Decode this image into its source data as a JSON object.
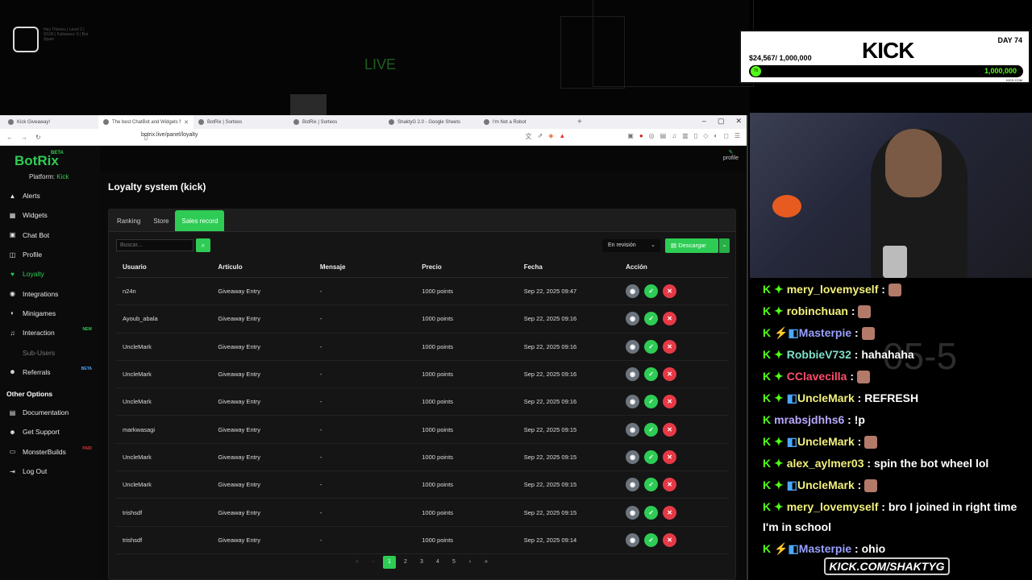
{
  "stream": {
    "bg_live": "LIVE",
    "bg_logo_text": "Hey Thieves | Level 2 | 0/100 | Followers: 0 | Bot Spam",
    "goal": {
      "amount": "$24,567/ 1,000,000",
      "brand": "KICK",
      "day": "DAY 74",
      "knob": "75",
      "target": "1,000,000",
      "site": "KICK.COM"
    },
    "chat_bg_number": "05-5",
    "kick_link": "KICK.COM/SHAKTYG",
    "chat": [
      {
        "badges": "K ✦",
        "badge2": "",
        "name": "mery_lovemyself",
        "name_color": "#f2f07a",
        "msg": "",
        "emote": true
      },
      {
        "badges": "K ✦",
        "badge2": "",
        "name": "robinchuan",
        "name_color": "#f2f07a",
        "msg": "",
        "emote": true
      },
      {
        "badges": "K",
        "badge2": "⚡◧",
        "name": "Masterpie",
        "name_color": "#9aa0ff",
        "msg": "",
        "emote": true
      },
      {
        "badges": "K ✦",
        "badge2": "",
        "name": "RobbieV732",
        "name_color": "#7ee0c9",
        "msg": "hahahaha",
        "emote": false
      },
      {
        "badges": "K ✦",
        "badge2": "",
        "name": "CClavecilla",
        "name_color": "#ff4d6d",
        "msg": "",
        "emote": true
      },
      {
        "badges": "K ✦",
        "badge2": "◧",
        "name": "UncleMark",
        "name_color": "#f2f07a",
        "msg": "REFRESH",
        "emote": false
      },
      {
        "badges": "K",
        "badge2": "",
        "name": "mrabsjdhhs6",
        "name_color": "#b9a8ff",
        "msg": "!p",
        "emote": false
      },
      {
        "badges": "K ✦",
        "badge2": "◧",
        "name": "UncleMark",
        "name_color": "#f2f07a",
        "msg": "",
        "emote": true
      },
      {
        "badges": "K ✦",
        "badge2": "",
        "name": "alex_aylmer03",
        "name_color": "#f2f07a",
        "msg": "spin the bot wheel lol",
        "emote": false
      },
      {
        "badges": "K ✦",
        "badge2": "◧",
        "name": "UncleMark",
        "name_color": "#f2f07a",
        "msg": "",
        "emote": true
      },
      {
        "badges": "K ✦",
        "badge2": "",
        "name": "mery_lovemyself",
        "name_color": "#f2f07a",
        "msg": "bro I joined in right time I'm in school",
        "emote": false
      },
      {
        "badges": "K",
        "badge2": "⚡◧",
        "name": "Masterpie",
        "name_color": "#9aa0ff",
        "msg": "ohio",
        "emote": false
      }
    ]
  },
  "browser": {
    "tabs": [
      {
        "label": "Kick Giveaway!",
        "active": false
      },
      {
        "label": "The best ChatBot and Widgets f",
        "active": true
      },
      {
        "label": "BotRix | Sorteos",
        "active": false
      },
      {
        "label": "BotRix | Sorteos",
        "active": false
      },
      {
        "label": "ShaktyG 2.0 - Google Sheets",
        "active": false
      },
      {
        "label": "I'm Not a Robot",
        "active": false
      }
    ],
    "url": "botrix.live/panel/loyalty"
  },
  "app": {
    "brand": "BotRix",
    "brand_beta": "BETA",
    "platform_label": "Platform:",
    "platform_value": "Kick",
    "profile_label": "profile",
    "page_title": "Loyalty system (kick)",
    "sidebar": [
      {
        "label": "Alerts",
        "icon": "▲",
        "name": "alerts",
        "state": "",
        "tag": "",
        "tag_color": ""
      },
      {
        "label": "Widgets",
        "icon": "▦",
        "name": "widgets",
        "state": "",
        "tag": "",
        "tag_color": ""
      },
      {
        "label": "Chat Bot",
        "icon": "▣",
        "name": "chat-bot",
        "state": "",
        "tag": "",
        "tag_color": ""
      },
      {
        "label": "Profile",
        "icon": "◫",
        "name": "profile",
        "state": "",
        "tag": "",
        "tag_color": ""
      },
      {
        "label": "Loyalty",
        "icon": "♥",
        "name": "loyalty",
        "state": "active",
        "tag": "",
        "tag_color": ""
      },
      {
        "label": "Integrations",
        "icon": "◉",
        "name": "integrations",
        "state": "",
        "tag": "",
        "tag_color": ""
      },
      {
        "label": "Minigames",
        "icon": "◐",
        "name": "minigames",
        "state": "",
        "tag": "",
        "tag_color": ""
      },
      {
        "label": "Interaction",
        "icon": "♫",
        "name": "interaction",
        "state": "",
        "tag": "NEW",
        "tag_color": "green"
      },
      {
        "label": "Sub-Users",
        "icon": "",
        "name": "sub-users",
        "state": "dim",
        "tag": "",
        "tag_color": ""
      },
      {
        "label": "Referrals",
        "icon": "☻",
        "name": "referrals",
        "state": "",
        "tag": "BETA",
        "tag_color": "blue"
      }
    ],
    "other_heading": "Other Options",
    "other": [
      {
        "label": "Documentation",
        "icon": "▤",
        "name": "documentation",
        "tag": "",
        "tag_color": ""
      },
      {
        "label": "Get Support",
        "icon": "☻",
        "name": "get-support",
        "tag": "",
        "tag_color": ""
      },
      {
        "label": "MonsterBuilds",
        "icon": "▭",
        "name": "monsterbuilds",
        "tag": "PAID",
        "tag_color": "red"
      },
      {
        "label": "Log Out",
        "icon": "⇥",
        "name": "log-out",
        "tag": "",
        "tag_color": ""
      }
    ],
    "tabs": [
      {
        "label": "Ranking",
        "active": false
      },
      {
        "label": "Store",
        "active": false
      },
      {
        "label": "Sales record",
        "active": true
      }
    ],
    "search_placeholder": "Buscar...",
    "status_value": "En revisión",
    "download_label": "Descargar",
    "columns": [
      "Usuario",
      "Artículo",
      "Mensaje",
      "Precio",
      "Fecha",
      "Acción"
    ],
    "rows": [
      [
        "n24n",
        "Giveaway Entry",
        "-",
        "1000 points",
        "Sep 22, 2025 09:47"
      ],
      [
        "Ayoub_abala",
        "Giveaway Entry",
        "-",
        "1000 points",
        "Sep 22, 2025 09:16"
      ],
      [
        "UncleMark",
        "Giveaway Entry",
        "-",
        "1000 points",
        "Sep 22, 2025 09:16"
      ],
      [
        "UncleMark",
        "Giveaway Entry",
        "-",
        "1000 points",
        "Sep 22, 2025 09:16"
      ],
      [
        "UncleMark",
        "Giveaway Entry",
        "-",
        "1000 points",
        "Sep 22, 2025 09:16"
      ],
      [
        "markwasagi",
        "Giveaway Entry",
        "-",
        "1000 points",
        "Sep 22, 2025 09:15"
      ],
      [
        "UncleMark",
        "Giveaway Entry",
        "-",
        "1000 points",
        "Sep 22, 2025 09:15"
      ],
      [
        "UncleMark",
        "Giveaway Entry",
        "-",
        "1000 points",
        "Sep 22, 2025 09:15"
      ],
      [
        "trishsdf",
        "Giveaway Entry",
        "-",
        "1000 points",
        "Sep 22, 2025 09:15"
      ],
      [
        "trishsdf",
        "Giveaway Entry",
        "-",
        "1000 points",
        "Sep 22, 2025 09:14"
      ]
    ],
    "pager": [
      "«",
      "‹",
      "1",
      "2",
      "3",
      "4",
      "5",
      "›",
      "»"
    ],
    "pager_active": "1"
  }
}
